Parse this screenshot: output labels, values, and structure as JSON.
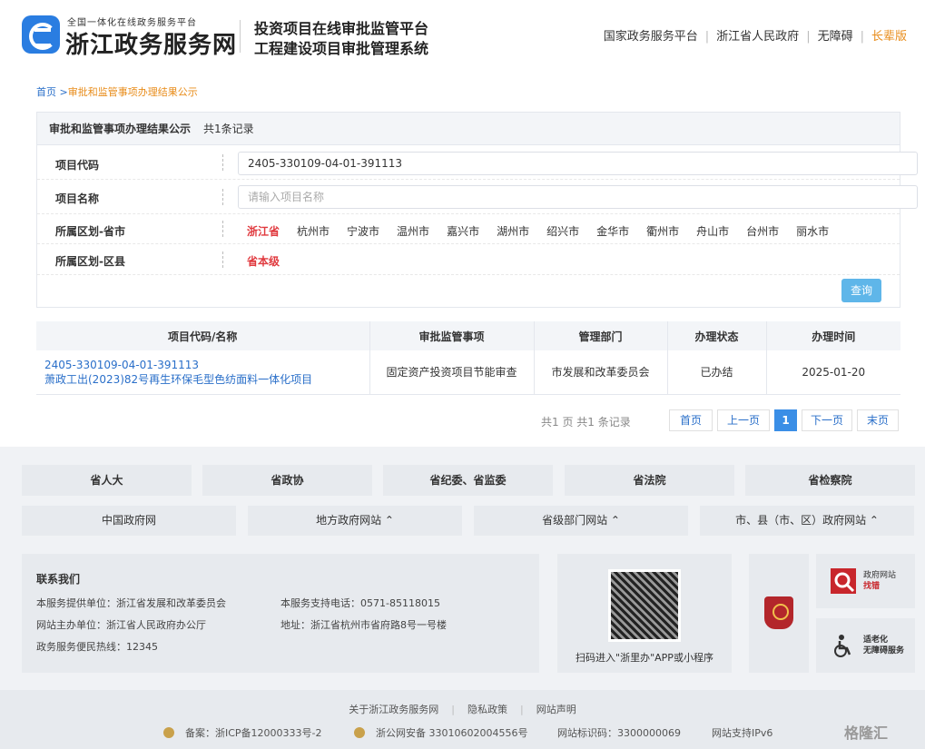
{
  "header": {
    "logo_small": "全国一体化在线政务服务平台",
    "logo_big": "浙江政务服务网",
    "sys_title1": "投资项目在线审批监管平台",
    "sys_title2": "工程建设项目审批管理系统",
    "links": [
      "国家政务服务平台",
      "浙江省人民政府",
      "无障碍"
    ],
    "link_accent": "长辈版"
  },
  "breadcrumb": {
    "home": "首页",
    "sep": ">",
    "current": "审批和监管事项办理结果公示"
  },
  "panel": {
    "title": "审批和监管事项办理结果公示",
    "count": "共1条记录",
    "code_label": "项目代码",
    "code_value": "2405-330109-04-01-391113",
    "name_label": "项目名称",
    "name_placeholder": "请输入项目名称",
    "city_label": "所属区划-省市",
    "cities": [
      "浙江省",
      "杭州市",
      "宁波市",
      "温州市",
      "嘉兴市",
      "湖州市",
      "绍兴市",
      "金华市",
      "衢州市",
      "舟山市",
      "台州市",
      "丽水市"
    ],
    "county_label": "所属区划-区县",
    "county_value": "省本级",
    "query": "查询"
  },
  "table": {
    "headers": [
      "项目代码/名称",
      "审批监管事项",
      "管理部门",
      "办理状态",
      "办理时间"
    ],
    "rows": [
      {
        "code": "2405-330109-04-01-391113",
        "name": "萧政工出(2023)82号再生环保毛型色纺面料一体化项目",
        "item": "固定资产投资项目节能审查",
        "dept": "市发展和改革委员会",
        "status": "已办结",
        "time": "2025-01-20"
      }
    ]
  },
  "pager": {
    "info": "共1 页 共1 条记录",
    "first": "首页",
    "prev": "上一页",
    "current": "1",
    "next": "下一页",
    "last": "末页"
  },
  "footer": {
    "orgs": [
      "省人大",
      "省政协",
      "省纪委、省监委",
      "省法院",
      "省检察院"
    ],
    "links": [
      "中国政府网",
      "地方政府网站 ⌃",
      "省级部门网站 ⌃",
      "市、县（市、区）政府网站 ⌃"
    ],
    "contact_title": "联系我们",
    "contact": {
      "provider": "本服务提供单位：浙江省发展和改革委员会",
      "host": "网站主办单位：浙江省人民政府办公厅",
      "hotline": "政务服务便民热线：12345",
      "phone": "本服务支持电话：0571-85118015",
      "address": "地址：浙江省杭州市省府路8号一号楼"
    },
    "qr_caption": "扫码进入\"浙里办\"APP或小程序",
    "badge1": [
      "政府网站",
      "找错"
    ],
    "badge2": [
      "适老化",
      "无障碍服务"
    ],
    "bottom_links": [
      "关于浙江政务服务网",
      "隐私政策",
      "网站声明"
    ],
    "icp": "备案：浙ICP备12000333号-2",
    "police": "浙公网安备 33010602004556号",
    "site_code": "网站标识码：3300000069",
    "ipv6": "网站支持IPv6",
    "watermark": "格隆汇"
  },
  "colors": {
    "accent_orange": "#e88c1a",
    "link_blue": "#2a6fc9",
    "active_red": "#e0393e",
    "query_blue": "#5fb6e9"
  }
}
